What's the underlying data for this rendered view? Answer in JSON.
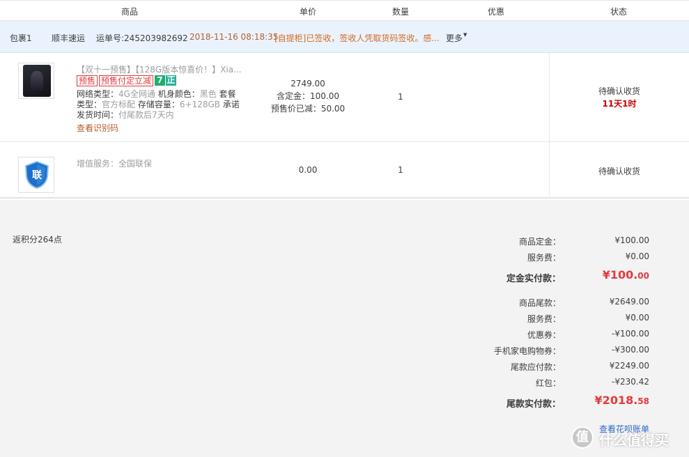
{
  "header": {
    "col_product": "商品",
    "col_price": "单价",
    "col_qty": "数量",
    "col_discount": "优惠",
    "col_status": "状态"
  },
  "package": {
    "label": "包裹1",
    "carrier": "顺丰速运",
    "waybill": "运单号:245203982692",
    "time": "2018-11-16 08:18:35",
    "status": "[自提柜]已签收，签收人凭取货码签收。感...",
    "more": "更多"
  },
  "items": [
    {
      "title": "【双十一预售】【128G版本惊喜价！】Xia...",
      "tags": [
        "预售",
        "预售付定立减"
      ],
      "tag_icons": [
        "7",
        "正"
      ],
      "spec_lines": [
        {
          "k": "网络类型：",
          "v": "4G全网通"
        },
        {
          "k": "机身颜色：",
          "v": "黑色"
        },
        {
          "k": "套餐类型：",
          "v": "官方标配"
        },
        {
          "k": "存储容量：",
          "v": "6+128GB"
        },
        {
          "k": "承诺发货时间：",
          "v": "付尾款后7天内"
        }
      ],
      "spec_link": "查看识别码",
      "price": "2749.00",
      "deposit": "含定金：100.00",
      "presale_discount": "预售价已减：50.00",
      "qty": "1",
      "status": "待确认收货",
      "countdown": "11天1时"
    },
    {
      "service_label": "增值服务：",
      "service_value": "全国联保",
      "price": "0.00",
      "qty": "1",
      "status": "待确认收货",
      "icon_char": "联"
    }
  ],
  "summary": {
    "points": "返积分264点",
    "rows": [
      {
        "label": "商品定金：",
        "value": "¥100.00"
      },
      {
        "label": "服务费：",
        "value": "¥0.00"
      },
      {
        "label": "定金实付款：",
        "value_int": "¥100.",
        "value_dec": "00"
      },
      {
        "label": "商品尾款：",
        "value": "¥2649.00"
      },
      {
        "label": "服务费：",
        "value": "¥0.00"
      },
      {
        "label": "优惠券：",
        "value": "-¥100.00"
      },
      {
        "label": "手机家电购物券：",
        "value": "-¥300.00"
      },
      {
        "label": "尾款应付款：",
        "value": "¥2249.00"
      },
      {
        "label": "红包：",
        "value": "-¥230.42"
      },
      {
        "label": "尾款实付款：",
        "value_int": "¥2018.",
        "value_dec": "58"
      }
    ],
    "huabei_link": "查看花呗账单"
  },
  "watermark": {
    "logo_char": "值",
    "text": "什么值得买"
  },
  "colors": {
    "accent_red": "#e4393c",
    "countdown_red": "#c40000",
    "orange": "#b65d2a",
    "pkg_bar_bg": "#eaf3fd",
    "link_blue": "#3366cc"
  }
}
